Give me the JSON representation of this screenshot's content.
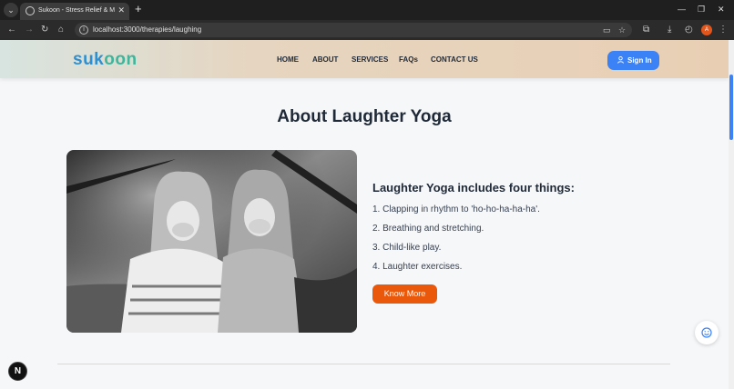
{
  "browser": {
    "tab_title": "Sukoon - Stress Relief & Mental",
    "url": "localhost:3000/therapies/laughing",
    "profile_initial": "A"
  },
  "header": {
    "logo_part1": "suk",
    "logo_part2": "oon",
    "nav": [
      "HOME",
      "ABOUT",
      "SERVICES",
      "FAQs",
      "CONTACT US"
    ],
    "signin_label": "Sign In"
  },
  "main": {
    "title": "About Laughter Yoga",
    "section_heading": "Laughter Yoga includes four things:",
    "items": [
      "1. Clapping in rhythm to 'ho-ho-ha-ha-ha'.",
      "2. Breathing and stretching.",
      "3. Child-like play.",
      "4. Laughter exercises."
    ],
    "cta_label": "Know More"
  },
  "widgets": {
    "next_badge": "N"
  },
  "colors": {
    "accent_blue": "#3b82f6",
    "cta_orange": "#ea580c",
    "logo_blue": "#2f8fd0",
    "logo_green": "#3fb59c"
  }
}
